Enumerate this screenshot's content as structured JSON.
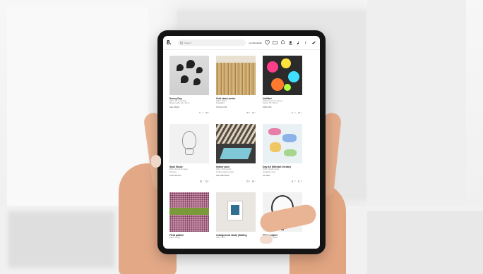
{
  "app": {
    "logo": "8.",
    "search_placeholder": "Search",
    "username": "yourhandlelab",
    "icons": [
      "heart-icon",
      "image-icon",
      "bell-icon",
      "user-icon",
      "music-icon",
      "facebook-icon",
      "twitter-icon"
    ]
  },
  "artworks": [
    {
      "title": "Sunny Day",
      "sub": "2021 / Oil on canvas",
      "sub2": "Mixed media, 40 x 30 cm",
      "artist": "LEE JIWON",
      "likes": "12",
      "views": "8",
      "thumb": "flowers"
    },
    {
      "title": "Grid stack series",
      "sub": "2020 / Wood",
      "sub2": "Installation",
      "artist": "STUDIO KIM",
      "likes": "5",
      "views": "3",
      "thumb": "wood"
    },
    {
      "title": "Untitled",
      "sub": "2022 / Acrylic on canvas",
      "sub2": "Acrylic, 50 x 50 cm",
      "artist": "PARK MIN",
      "likes": "24",
      "views": "11",
      "thumb": "neon"
    },
    {
      "title": "Skull Study",
      "sub": "2019 / Pencil on paper",
      "sub2": "Drawing",
      "artist": "Kenta Shimizu",
      "likes": "7",
      "views": "2",
      "thumb": "skull"
    },
    {
      "title": "Indoor pool",
      "sub": "2021 / Photograph",
      "sub2": "Archival pigment print",
      "artist": "HAN SEOYEON",
      "likes": "9",
      "views": "4",
      "thumb": "pool"
    },
    {
      "title": "Day Art (Michael Jordan)",
      "sub": "2022 / Mixed media",
      "sub2": "Installation view",
      "artist": "OH JIHO",
      "likes": "31",
      "views": "15",
      "thumb": "ribbons"
    },
    {
      "title": "Field pattern",
      "sub": "2020 / Acrylic",
      "sub2": "Acrylic on canvas",
      "artist": "",
      "likes": "",
      "views": "",
      "thumb": "dots"
    },
    {
      "title": "enlargement study (Sliding",
      "sub": "2021 / Print",
      "sub2": "Framed, 30 x 40 cm",
      "artist": "",
      "likes": "",
      "views": "",
      "thumb": "frame"
    },
    {
      "title": "Mirror object",
      "sub": "2022 / Steel, glass",
      "sub2": "Sculpture",
      "artist": "",
      "likes": "",
      "views": "",
      "thumb": "mirror"
    }
  ]
}
